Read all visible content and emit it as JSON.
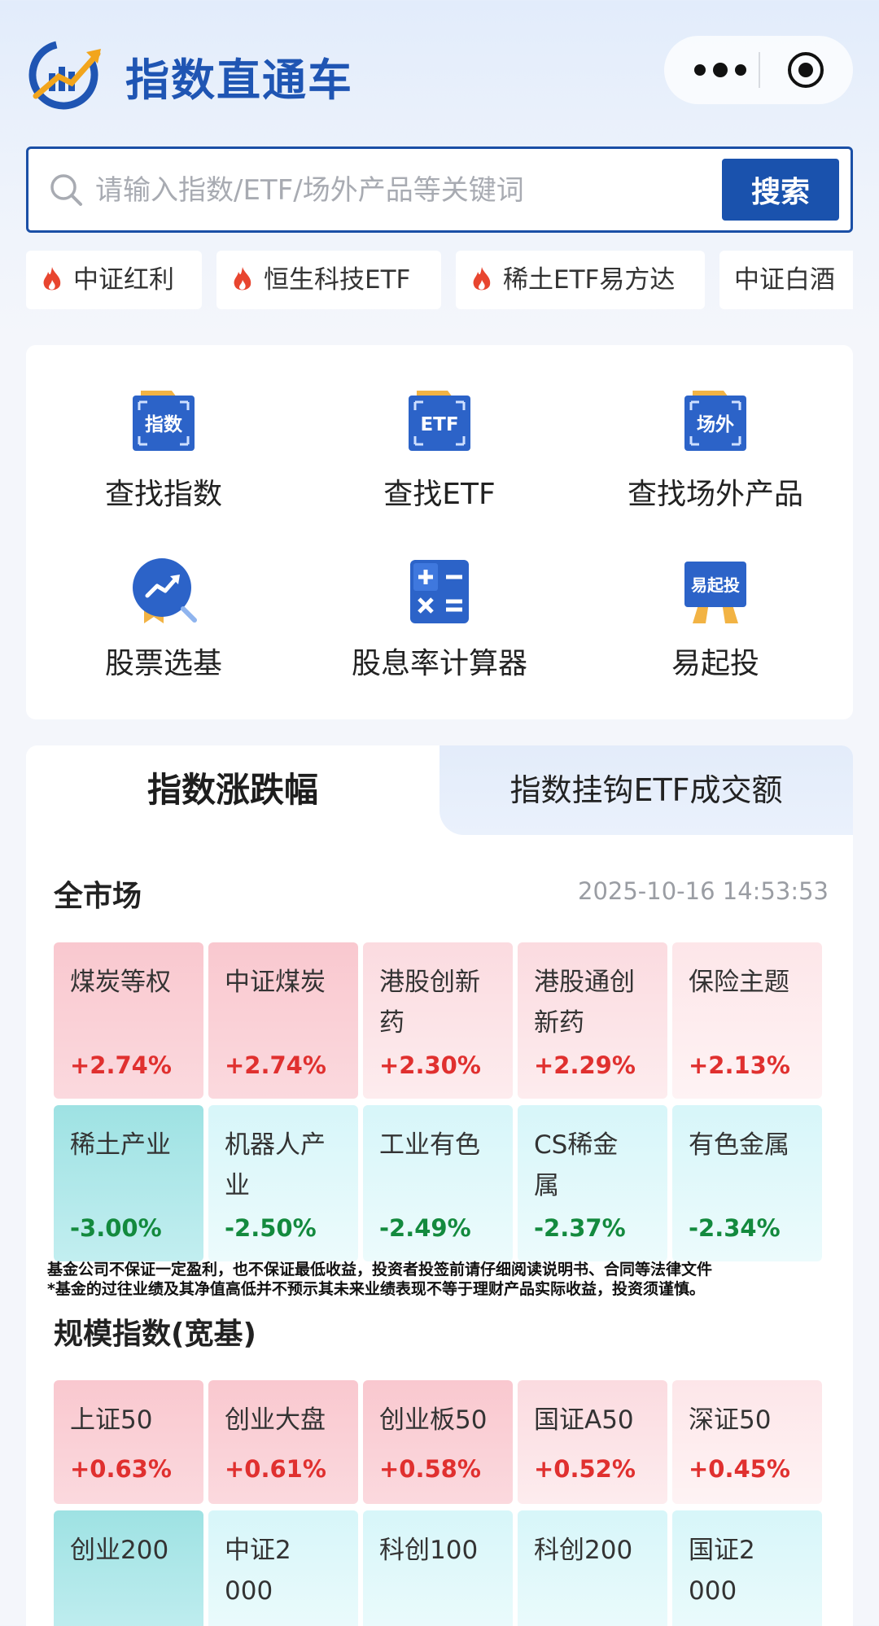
{
  "header": {
    "title": "指数直通车",
    "logo_icon": "chart-growth-logo-icon",
    "more_icon": "more-dots-icon",
    "close_icon": "target-close-icon"
  },
  "search": {
    "placeholder": "请输入指数/ETF/场外产品等关键词",
    "button_label": "搜索"
  },
  "hot_tags": [
    {
      "label": "中证红利",
      "hot": true
    },
    {
      "label": "恒生科技ETF",
      "hot": true
    },
    {
      "label": "稀土ETF易方达",
      "hot": true
    },
    {
      "label": "中证白酒",
      "hot": false
    }
  ],
  "tools": [
    {
      "label": "查找指数",
      "icon_text": "指数",
      "icon": "index-icon"
    },
    {
      "label": "查找ETF",
      "icon_text": "ETF",
      "icon": "etf-icon"
    },
    {
      "label": "查找场外产品",
      "icon_text": "场外",
      "icon": "otc-icon"
    },
    {
      "label": "股票选基",
      "icon_text": "",
      "icon": "stock-pick-icon"
    },
    {
      "label": "股息率计算器",
      "icon_text": "",
      "icon": "calculator-icon"
    },
    {
      "label": "易起投",
      "icon_text": "易起投",
      "icon": "easy-invest-icon"
    }
  ],
  "tabs": {
    "active": "指数涨跌幅",
    "inactive": "指数挂钩ETF成交额"
  },
  "all_market": {
    "title": "全市场",
    "timestamp": "2025-10-16 14:53:53",
    "gainers": [
      {
        "name": "煤炭等权",
        "change": "+2.74%"
      },
      {
        "name": "中证煤炭",
        "change": "+2.74%"
      },
      {
        "name": "港股创新药",
        "change": "+2.30%"
      },
      {
        "name": "港股通创新药",
        "change": "+2.29%"
      },
      {
        "name": "保险主题",
        "change": "+2.13%"
      }
    ],
    "losers": [
      {
        "name": "稀土产业",
        "change": "-3.00%"
      },
      {
        "name": "机器人产业",
        "change": "-2.50%"
      },
      {
        "name": "工业有色",
        "change": "-2.49%"
      },
      {
        "name": "CS稀金属",
        "change": "-2.37%"
      },
      {
        "name": "有色金属",
        "change": "-2.34%"
      }
    ]
  },
  "disclaimer": {
    "line1": "基金公司不保证一定盈利，也不保证最低收益，投资者投签前请仔细阅读说明书、合同等法律文件",
    "line2": "*基金的过往业绩及其净值高低并不预示其未来业绩表现不等于理财产品实际收益，投资须谨慎。"
  },
  "broad_index": {
    "title": "规模指数(宽基)",
    "gainers": [
      {
        "name": "上证50",
        "change": "+0.63%"
      },
      {
        "name": "创业大盘",
        "change": "+0.61%"
      },
      {
        "name": "创业板50",
        "change": "+0.58%"
      },
      {
        "name": "国证A50",
        "change": "+0.52%"
      },
      {
        "name": "深证50",
        "change": "+0.45%"
      }
    ],
    "losers": [
      {
        "name": "创业200",
        "change": ""
      },
      {
        "name": "中证2000",
        "change": ""
      },
      {
        "name": "科创100",
        "change": ""
      },
      {
        "name": "科创200",
        "change": ""
      },
      {
        "name": "国证2000",
        "change": ""
      }
    ]
  },
  "colors": {
    "brand": "#1a52ad",
    "up": "#e0302f",
    "down": "#138a3e"
  }
}
